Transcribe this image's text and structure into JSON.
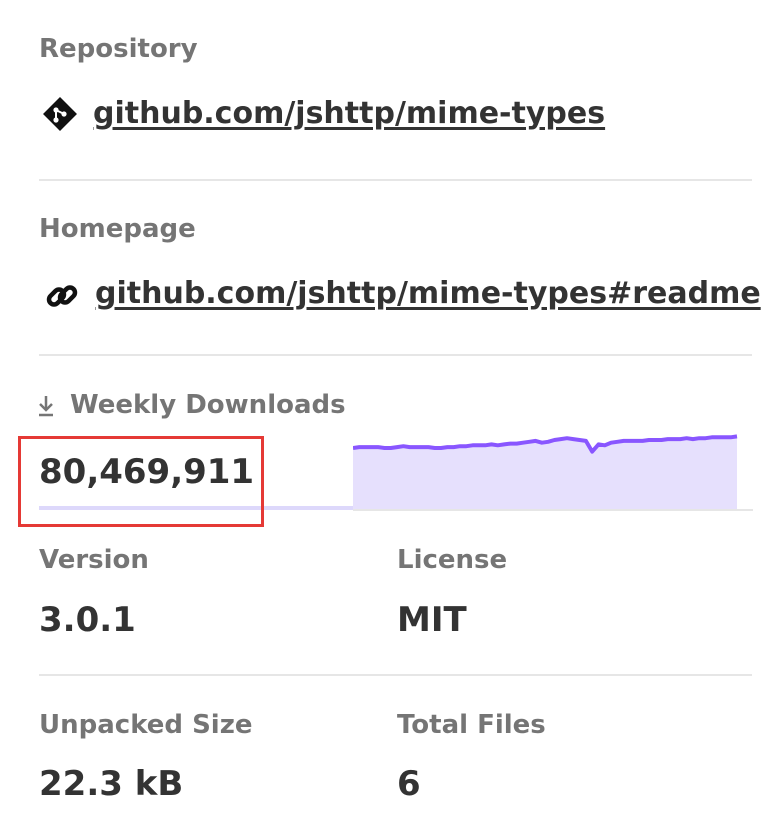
{
  "repository": {
    "label": "Repository",
    "link_text": "github.com/jshttp/mime-types",
    "icon": "git-icon"
  },
  "homepage": {
    "label": "Homepage",
    "link_text": "github.com/jshttp/mime-types#readme",
    "icon": "link-icon"
  },
  "weekly_downloads": {
    "label": "Weekly Downloads",
    "icon": "download-icon",
    "count": "80,469,911",
    "sparkline_color": "#8956ff",
    "sparkline_fill": "#e6e0fd",
    "highlight_color": "#e53935",
    "sparkline_values": [
      72,
      73,
      73,
      73,
      73,
      72,
      72,
      73,
      74,
      73,
      73,
      73,
      73,
      72,
      72,
      73,
      73,
      74,
      74,
      75,
      75,
      75,
      76,
      75,
      76,
      77,
      77,
      78,
      79,
      80,
      78,
      79,
      81,
      82,
      83,
      82,
      81,
      80,
      68,
      76,
      75,
      78,
      79,
      80,
      80,
      80,
      80,
      81,
      81,
      81,
      82,
      82,
      82,
      83,
      82,
      83,
      83,
      84,
      84,
      84,
      84,
      85
    ]
  },
  "version": {
    "label": "Version",
    "value": "3.0.1"
  },
  "license": {
    "label": "License",
    "value": "MIT"
  },
  "unpacked_size": {
    "label": "Unpacked Size",
    "value": "22.3 kB"
  },
  "total_files": {
    "label": "Total Files",
    "value": "6"
  }
}
